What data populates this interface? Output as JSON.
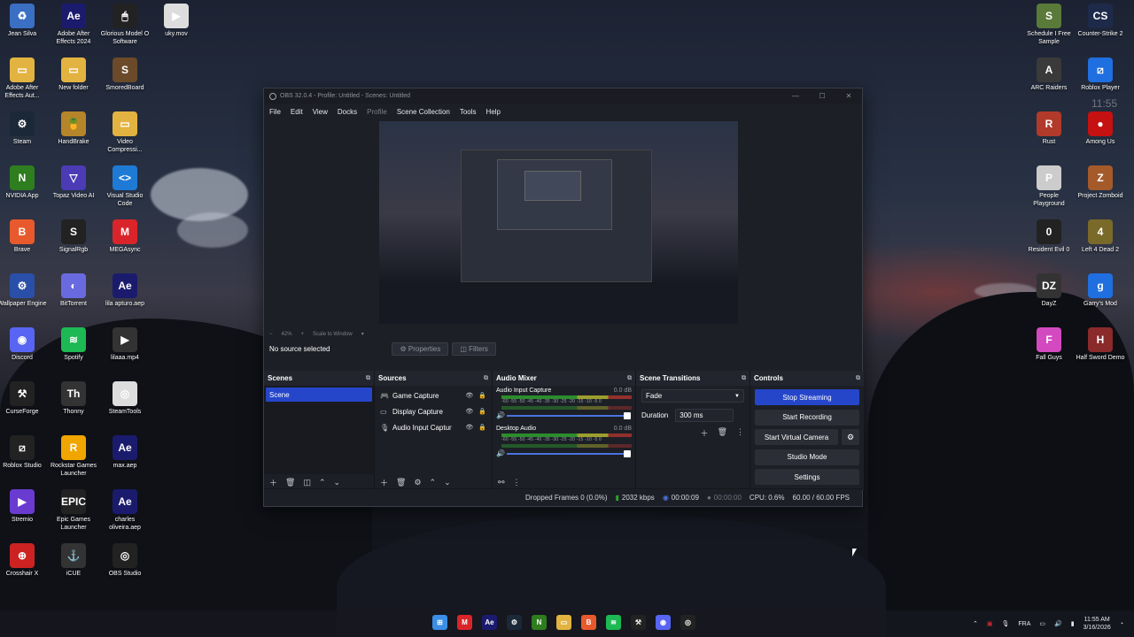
{
  "desktop": {
    "icons_left": [
      {
        "label": "Jean Silva",
        "icon": "recycle-bin-icon",
        "color": "#3a6fc4",
        "glyph": "♻"
      },
      {
        "label": "Adobe After Effects 2024",
        "icon": "after-effects-icon",
        "color": "#1b1b6e",
        "glyph": "Ae"
      },
      {
        "label": "Glorious Model O Software",
        "icon": "mouse-icon",
        "color": "#222",
        "glyph": "🖱"
      },
      {
        "label": "uky.mov",
        "icon": "video-file-icon",
        "color": "#ddd",
        "glyph": "▶"
      },
      {
        "label": "Adobe After Effects Aut...",
        "icon": "folder-icon",
        "color": "#e3b341",
        "glyph": "▭"
      },
      {
        "label": "New folder",
        "icon": "folder-icon",
        "color": "#e3b341",
        "glyph": "▭"
      },
      {
        "label": "SmoredBoard",
        "icon": "app-icon",
        "color": "#6b4a2a",
        "glyph": "S"
      },
      {
        "label": "Steam",
        "icon": "steam-icon",
        "color": "#1b2838",
        "glyph": "⚙"
      },
      {
        "label": "HandBrake",
        "icon": "handbrake-icon",
        "color": "#b5852a",
        "glyph": "🍍"
      },
      {
        "label": "Video Compressi...",
        "icon": "folder-icon",
        "color": "#e3b341",
        "glyph": "▭"
      },
      {
        "label": "NVIDIA App",
        "icon": "nvidia-icon",
        "color": "#2e7d1f",
        "glyph": "N"
      },
      {
        "label": "Topaz Video AI",
        "icon": "topaz-icon",
        "color": "#4b3bb5",
        "glyph": "▽"
      },
      {
        "label": "Visual Studio Code",
        "icon": "vscode-icon",
        "color": "#1f7ad6",
        "glyph": "<>"
      },
      {
        "label": "Brave",
        "icon": "brave-icon",
        "color": "#e85a2d",
        "glyph": "B"
      },
      {
        "label": "SignalRgb",
        "icon": "signalrgb-icon",
        "color": "#222",
        "glyph": "S"
      },
      {
        "label": "MEGAsync",
        "icon": "mega-icon",
        "color": "#d9252a",
        "glyph": "M"
      },
      {
        "label": "Wallpaper Engine",
        "icon": "wallpaper-engine-icon",
        "color": "#2a4fa8",
        "glyph": "⚙"
      },
      {
        "label": "BitTorrent",
        "icon": "bittorrent-icon",
        "color": "#6a6ae0",
        "glyph": "◐"
      },
      {
        "label": "lila apturo.aep",
        "icon": "aep-file-icon",
        "color": "#1b1b6e",
        "glyph": "Ae"
      },
      {
        "label": "Discord",
        "icon": "discord-icon",
        "color": "#5865f2",
        "glyph": "◉"
      },
      {
        "label": "Spotify",
        "icon": "spotify-icon",
        "color": "#1db954",
        "glyph": "≋"
      },
      {
        "label": "lilaaa.mp4",
        "icon": "video-thumb-icon",
        "color": "#333",
        "glyph": "▶"
      },
      {
        "label": "CurseForge",
        "icon": "curseforge-icon",
        "color": "#222",
        "glyph": "⚒"
      },
      {
        "label": "Thonny",
        "icon": "thonny-icon",
        "color": "#333",
        "glyph": "Th"
      },
      {
        "label": "SteamTools",
        "icon": "steamtools-icon",
        "color": "#ddd",
        "glyph": "◎"
      },
      {
        "label": "Roblox Studio",
        "icon": "roblox-studio-icon",
        "color": "#222",
        "glyph": "⧄"
      },
      {
        "label": "Rockstar Games Launcher",
        "icon": "rockstar-icon",
        "color": "#f0a500",
        "glyph": "R"
      },
      {
        "label": "max.aep",
        "icon": "aep-file-icon",
        "color": "#1b1b6e",
        "glyph": "Ae"
      },
      {
        "label": "Stremio",
        "icon": "stremio-icon",
        "color": "#6a3bd1",
        "glyph": "▶"
      },
      {
        "label": "Epic Games Launcher",
        "icon": "epic-icon",
        "color": "#222",
        "glyph": "EPIC"
      },
      {
        "label": "charles oliveira.aep",
        "icon": "aep-file-icon",
        "color": "#1b1b6e",
        "glyph": "Ae"
      },
      {
        "label": "Crosshair X",
        "icon": "crosshair-icon",
        "color": "#c22",
        "glyph": "⊕"
      },
      {
        "label": "iCUE",
        "icon": "icue-icon",
        "color": "#333",
        "glyph": "⚓"
      },
      {
        "label": "OBS Studio",
        "icon": "obs-icon",
        "color": "#222",
        "glyph": "◎"
      }
    ],
    "icons_right": [
      {
        "label": "Schedule I Free Sample",
        "icon": "game-icon",
        "color": "#5a7a3a",
        "glyph": "S"
      },
      {
        "label": "Counter-Strike 2",
        "icon": "cs2-icon",
        "color": "#1e2a4a",
        "glyph": "CS"
      },
      {
        "label": "ARC Raiders",
        "icon": "arc-raiders-icon",
        "color": "#3a3a3a",
        "glyph": "A"
      },
      {
        "label": "Roblox Player",
        "icon": "roblox-icon",
        "color": "#1f6fe0",
        "glyph": "⧄"
      },
      {
        "label": "Rust",
        "icon": "rust-icon",
        "color": "#b23a2a",
        "glyph": "R"
      },
      {
        "label": "Among Us",
        "icon": "among-us-icon",
        "color": "#c51111",
        "glyph": "●"
      },
      {
        "label": "People Playground",
        "icon": "game-icon",
        "color": "#ccc",
        "glyph": "P"
      },
      {
        "label": "Project Zomboid",
        "icon": "zomboid-icon",
        "color": "#a55a2a",
        "glyph": "Z"
      },
      {
        "label": "Resident Evil 0",
        "icon": "re0-icon",
        "color": "#222",
        "glyph": "0"
      },
      {
        "label": "Left 4 Dead 2",
        "icon": "l4d2-icon",
        "color": "#7a6a2a",
        "glyph": "4"
      },
      {
        "label": "DayZ",
        "icon": "dayz-icon",
        "color": "#333",
        "glyph": "DZ"
      },
      {
        "label": "Garry's Mod",
        "icon": "gmod-icon",
        "color": "#1f6fe0",
        "glyph": "g"
      },
      {
        "label": "Fall Guys",
        "icon": "fall-guys-icon",
        "color": "#d34ac0",
        "glyph": "F"
      },
      {
        "label": "Half Sword Demo",
        "icon": "half-sword-icon",
        "color": "#8a2a2a",
        "glyph": "H"
      }
    ],
    "side_clock": "11:55"
  },
  "obs": {
    "title": "OBS 32.0.4 - Profile: Untitled - Scenes: Untitled",
    "menu": [
      "File",
      "Edit",
      "View",
      "Docks",
      "Profile",
      "Scene Collection",
      "Tools",
      "Help"
    ],
    "zoom": "42%",
    "scale_mode": "Scale to Window",
    "source_status": "No source selected",
    "properties_label": "Properties",
    "filters_label": "Filters",
    "scenes": {
      "title": "Scenes",
      "items": [
        "Scene"
      ]
    },
    "sources": {
      "title": "Sources",
      "items": [
        {
          "name": "Game Capture",
          "icon": "gamepad-icon"
        },
        {
          "name": "Display Capture",
          "icon": "monitor-icon"
        },
        {
          "name": "Audio Input Captur",
          "icon": "microphone-icon"
        }
      ]
    },
    "mixer": {
      "title": "Audio Mixer",
      "channels": [
        {
          "name": "Audio Input Capture",
          "db": "0.0 dB"
        },
        {
          "name": "Desktop Audio",
          "db": "0.0 dB"
        }
      ],
      "scale": "-60 -55 -50 -45 -40 -35 -30 -25 -20 -15 -10 -5 0"
    },
    "transitions": {
      "title": "Scene Transitions",
      "type": "Fade",
      "duration_label": "Duration",
      "duration": "300 ms"
    },
    "controls": {
      "title": "Controls",
      "stop_streaming": "Stop Streaming",
      "start_recording": "Start Recording",
      "start_virtual_camera": "Start Virtual Camera",
      "studio_mode": "Studio Mode",
      "settings": "Settings"
    },
    "status": {
      "dropped": "Dropped Frames 0 (0.0%)",
      "bitrate": "2032 kbps",
      "stream_time": "00:00:09",
      "rec_time": "00:00:00",
      "cpu": "CPU: 0.6%",
      "fps": "60.00 / 60.00 FPS"
    }
  },
  "taskbar": {
    "apps": [
      {
        "icon": "windows-start-icon",
        "color": "#3a8ee6",
        "glyph": "⊞"
      },
      {
        "icon": "mega-icon",
        "color": "#d9252a",
        "glyph": "M"
      },
      {
        "icon": "after-effects-icon",
        "color": "#1b1b6e",
        "glyph": "Ae"
      },
      {
        "icon": "steam-icon",
        "color": "#1b2838",
        "glyph": "⚙"
      },
      {
        "icon": "nvidia-icon",
        "color": "#2e7d1f",
        "glyph": "N"
      },
      {
        "icon": "file-explorer-icon",
        "color": "#e3b341",
        "glyph": "▭"
      },
      {
        "icon": "brave-icon",
        "color": "#e85a2d",
        "glyph": "B"
      },
      {
        "icon": "spotify-icon",
        "color": "#1db954",
        "glyph": "≋"
      },
      {
        "icon": "curseforge-icon",
        "color": "#222",
        "glyph": "⚒"
      },
      {
        "icon": "discord-icon",
        "color": "#5865f2",
        "glyph": "◉"
      },
      {
        "icon": "obs-icon",
        "color": "#222",
        "glyph": "◎"
      }
    ],
    "lang": "FRA",
    "time": "11:55 AM",
    "date": "3/16/2026"
  }
}
